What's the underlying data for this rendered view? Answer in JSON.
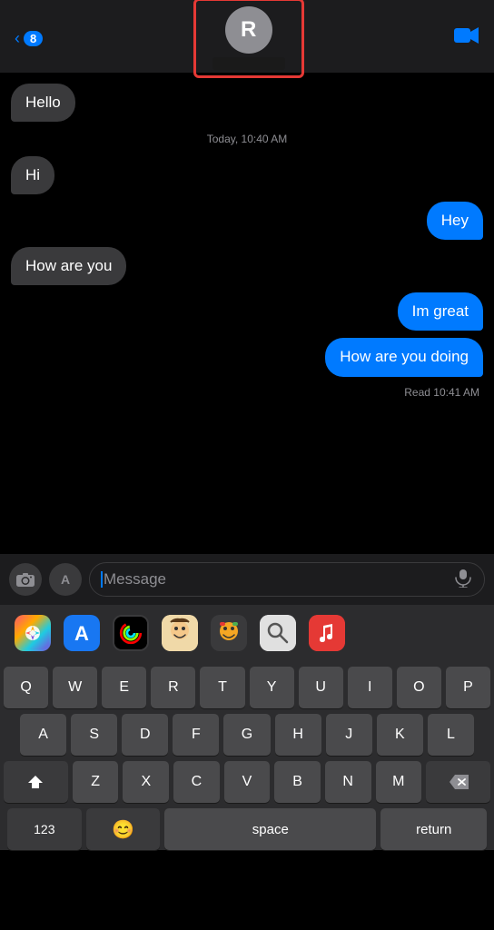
{
  "header": {
    "back_count": "8",
    "contact_initial": "R",
    "video_icon": "📹"
  },
  "messages": [
    {
      "id": 1,
      "type": "received",
      "text": "Hello"
    },
    {
      "id": 2,
      "type": "timestamp",
      "text": "Today, 10:40 AM"
    },
    {
      "id": 3,
      "type": "received",
      "text": "Hi"
    },
    {
      "id": 4,
      "type": "sent",
      "text": "Hey"
    },
    {
      "id": 5,
      "type": "received",
      "text": "How are you"
    },
    {
      "id": 6,
      "type": "sent",
      "text": "Im great"
    },
    {
      "id": 7,
      "type": "sent",
      "text": "How are you doing"
    }
  ],
  "read_receipt": "Read  10:41 AM",
  "input_bar": {
    "placeholder": "Message",
    "camera_icon": "📷",
    "apps_icon": "A",
    "audio_icon": "🎤"
  },
  "app_row": {
    "apps": [
      {
        "name": "Photos",
        "emoji": "🌅",
        "type": "photos"
      },
      {
        "name": "App Store",
        "emoji": "🅐",
        "type": "appstore"
      },
      {
        "name": "Activity",
        "emoji": "◎",
        "type": "activity"
      },
      {
        "name": "Memoji",
        "emoji": "🤩",
        "type": "memoji"
      },
      {
        "name": "Stickers",
        "emoji": "🤠",
        "type": "stickers"
      },
      {
        "name": "Search",
        "emoji": "🔍",
        "type": "search"
      },
      {
        "name": "Music",
        "emoji": "🎵",
        "type": "music"
      }
    ]
  },
  "keyboard": {
    "rows": [
      [
        "Q",
        "W",
        "E",
        "R",
        "T",
        "Y",
        "U",
        "I",
        "O",
        "P"
      ],
      [
        "A",
        "S",
        "D",
        "F",
        "G",
        "H",
        "J",
        "K",
        "L"
      ],
      [
        "Z",
        "X",
        "C",
        "V",
        "B",
        "N",
        "M"
      ]
    ],
    "shift_label": "⬆",
    "delete_label": "⌫",
    "numbers_label": "123",
    "emoji_label": "😊",
    "space_label": "space",
    "return_label": "return"
  }
}
